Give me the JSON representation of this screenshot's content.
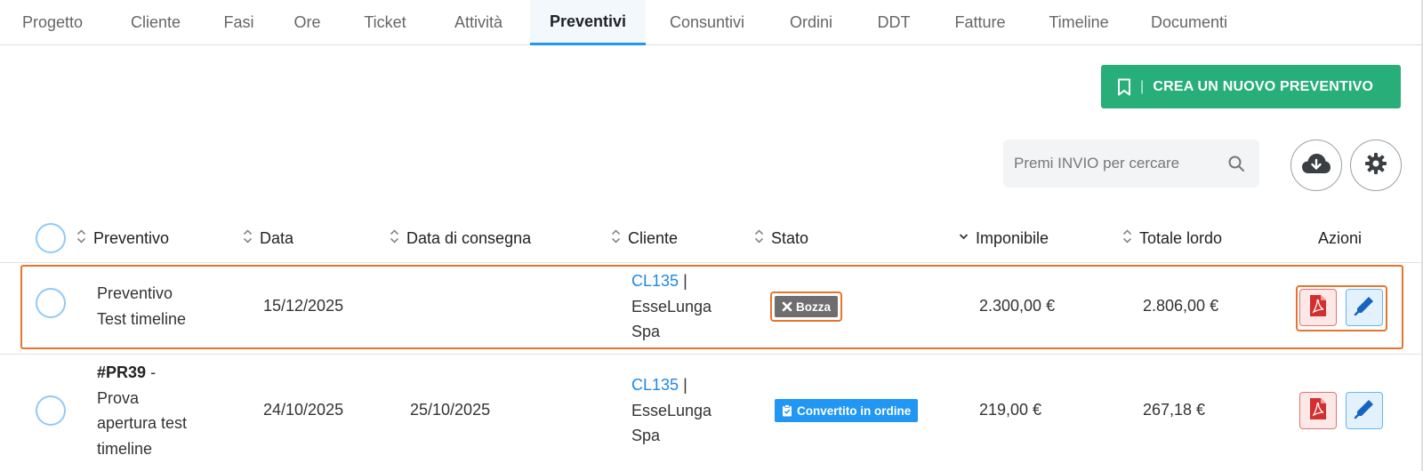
{
  "tabs": [
    {
      "label": "Progetto"
    },
    {
      "label": "Cliente"
    },
    {
      "label": "Fasi"
    },
    {
      "label": "Ore"
    },
    {
      "label": "Ticket"
    },
    {
      "label": "Attività"
    },
    {
      "label": "Preventivi",
      "active": true
    },
    {
      "label": "Consuntivi"
    },
    {
      "label": "Ordini"
    },
    {
      "label": "DDT"
    },
    {
      "label": "Fatture"
    },
    {
      "label": "Timeline"
    },
    {
      "label": "Documenti"
    }
  ],
  "toolbar": {
    "create_label": "CREA UN NUOVO PREVENTIVO",
    "create_separator": "|",
    "search_placeholder": "Premi INVIO per cercare",
    "download_icon": "cloud-download-icon",
    "settings_icon": "gear-icon",
    "accent": "#27ae79"
  },
  "table": {
    "columns": {
      "preventivo": "Preventivo",
      "data": "Data",
      "consegna": "Data di consegna",
      "cliente": "Cliente",
      "stato": "Stato",
      "imponibile": "Imponibile",
      "totale": "Totale lordo",
      "azioni": "Azioni"
    },
    "rows": [
      {
        "title_line1": "Preventivo",
        "title_line2": "Test timeline",
        "data": "15/12/2025",
        "consegna": "",
        "client_code": "CL135",
        "client_sep": "|",
        "client_name_1": "EsseLunga",
        "client_name_2": "Spa",
        "status": "Bozza",
        "status_color": "#6e6e6e",
        "imponibile": "2.300,00 €",
        "totale": "2.806,00 €"
      },
      {
        "code": "#PR39",
        "code_dash": "-",
        "title_line1": "Prova",
        "title_line2": "apertura test",
        "title_line3": "timeline",
        "data": "24/10/2025",
        "consegna": "25/10/2025",
        "client_code": "CL135",
        "client_sep": "|",
        "client_name_1": "EsseLunga",
        "client_name_2": "Spa",
        "status": "Convertito in ordine",
        "status_color": "#2196f3",
        "imponibile": "219,00 €",
        "totale": "267,18 €"
      }
    ]
  }
}
